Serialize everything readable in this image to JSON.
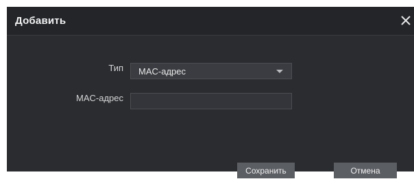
{
  "dialog": {
    "title": "Добавить",
    "close_icon": "close-icon"
  },
  "form": {
    "type_label": "Тип",
    "type_value": "MAC-адрес",
    "mac_label": "MAC-адрес",
    "mac_value": "",
    "mac_placeholder": ""
  },
  "buttons": {
    "save_label": "Сохранить",
    "cancel_label": "Отмена"
  },
  "colors": {
    "dialog_bg": "#2a2c30",
    "header_bg": "#232529",
    "button_bg": "#5b5e63"
  }
}
